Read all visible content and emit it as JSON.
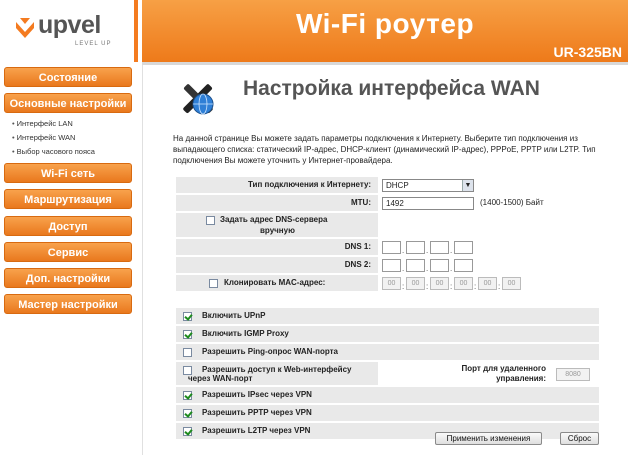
{
  "brand": {
    "logo_text": "upvel",
    "logo_sub": "LEVEL UP"
  },
  "header": {
    "title": "Wi-Fi роутер",
    "model": "UR-325BN"
  },
  "sidebar": {
    "items": [
      {
        "label": "Состояние"
      },
      {
        "label": "Основные настройки"
      },
      {
        "label": "Wi-Fi сеть"
      },
      {
        "label": "Маршрутизация"
      },
      {
        "label": "Доступ"
      },
      {
        "label": "Сервис"
      },
      {
        "label": "Доп. настройки"
      },
      {
        "label": "Мастер настройки"
      }
    ],
    "subitems": [
      {
        "label": "Интерфейс LAN"
      },
      {
        "label": "Интерфейс WAN"
      },
      {
        "label": "Выбор часового пояса"
      }
    ]
  },
  "page": {
    "icon": "tools-globe-icon",
    "title": "Настройка интерфейса WAN",
    "description": "На данной странице Вы можете задать параметры подключения к Интернету. Выберите тип подключения из выпадающего списка: статический IP-адрес, DHCP-клиент (динамический IP-адрес), PPPoE, PPTP или L2TP. Тип подключения Вы можете уточнить у Интернет-провайдера."
  },
  "form": {
    "connection_type_label": "Тип подключения к Интернету:",
    "connection_type_value": "DHCP",
    "mtu_label": "MTU:",
    "mtu_value": "1492",
    "mtu_hint": "(1400-1500) Байт",
    "dns_manual_label_1": "Задать адрес DNS-сервера",
    "dns_manual_label_2": "вручную",
    "dns1_label": "DNS 1:",
    "dns2_label": "DNS 2:",
    "clone_mac_label": "Клонировать MAC-адрес:",
    "mac_octets": [
      "00",
      "00",
      "00",
      "00",
      "00",
      "00"
    ]
  },
  "options": {
    "upnp": "Включить UPnP",
    "igmp": "Включить IGMP Proxy",
    "ping": "Разрешить Ping-опрос WAN-порта",
    "web_access_1": "Разрешить доступ к Web-интерфейсу",
    "web_access_2": "через WAN-порт",
    "remote_port_label_1": "Порт для удаленного",
    "remote_port_label_2": "управления:",
    "remote_port_value": "8080",
    "ipsec": "Разрешить IPsec через VPN",
    "pptp": "Разрешить PPTP через VPN",
    "l2tp": "Разрешить L2TP через VPN"
  },
  "buttons": {
    "apply": "Применить изменения",
    "reset": "Сброс"
  },
  "colors": {
    "accent": "#f47b20",
    "row_bg": "#e9e9e9"
  }
}
